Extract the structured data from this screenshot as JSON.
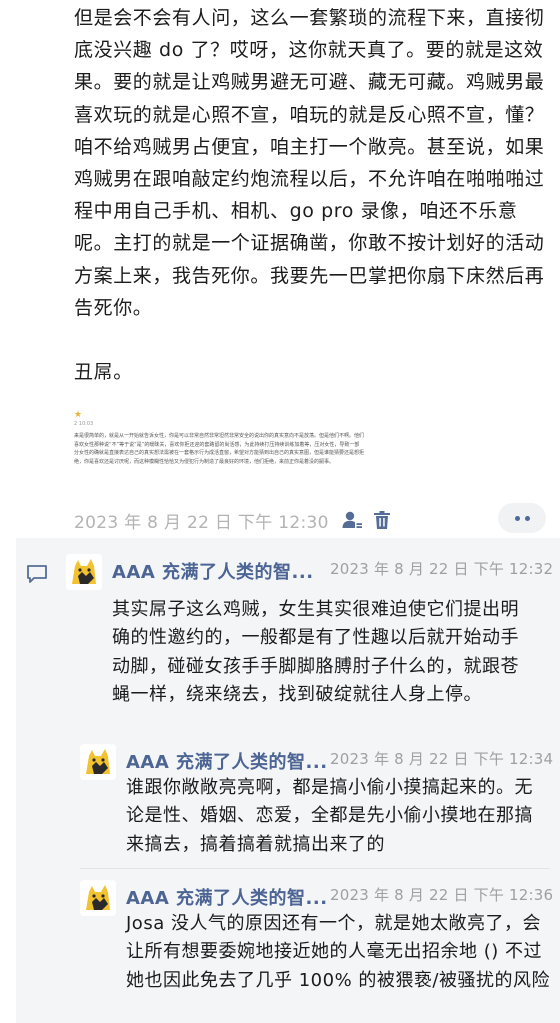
{
  "post": {
    "body_paragraph": "但是会不会有人问，这么一套繁琐的流程下来，直接彻底没兴趣 do 了？哎呀，这你就天真了。要的就是这效果。要的就是让鸡贼男避无可避、藏无可藏。鸡贼男最喜欢玩的就是心照不宣，咱玩的就是反心照不宣，懂？咱不给鸡贼男占便宜，咱主打一个敞亮。甚至说，如果鸡贼男在跟咱敲定约炮流程以后，不允许咱在啪啪啪过程中用自己手机、相机、go pro 录像，咱还不乐意呢。主打的就是一个证据确凿，你敢不按计划好的活动方案上来，我告死你。我要先一巴掌把你扇下床然后再告死你。",
    "closing_line": "丑屌。",
    "embedded_image": {
      "star": "★",
      "time": "2 10:03",
      "text": "来是很简单的，就是从一开始就告诉女性，你是可以非常自然非常坦然非常安全的说出你的真实意向不是放荡。但是他们不啊。他们喜欢女性那种说“不”等于说“是”的暧昧关，喜欢你拒还迎的套路留的尚活感，为此持续打压持续训练加着等，压对女性，导致一部分女性的确就是直接表达自己的真实想法需被在一套格示行为成活直窗，希望对方能猜到出自己的真实意图，但是谁能猜要还是想拒绝，你是喜欢还是讨厌呢，而这种模糊性恰恰又为侵犯行为制造了最良好的环境，他们拒绝，来前正你是着没的嗣事。"
    },
    "timestamp": "2023 年 8 月 22 日 下午 12:30"
  },
  "comments": [
    {
      "author": "AAA 充满了人类的智...",
      "time": "2023 年 8 月 22 日 下午 12:32",
      "text": "其实屌子这么鸡贼，女生其实很难迫使它们提出明确的性邀约的，一般都是有了性趣以后就开始动手动脚，碰碰女孩手手脚脚胳膊肘子什么的，就跟苍蝇一样，绕来绕去，找到破绽就往人身上停。"
    },
    {
      "author": "AAA 充满了人类的智...",
      "time": "2023 年 8 月 22 日 下午 12:34",
      "text": "谁跟你敞敞亮亮啊，都是搞小偷小摸搞起来的。无论是性、婚姻、恋爱，全都是先小偷小摸地在那搞来搞去，搞着搞着就搞出来了的"
    },
    {
      "author": "AAA 充满了人类的智...",
      "time": "2023 年 8 月 22 日 下午 12:36",
      "text": "Josa 没人气的原因还有一个，就是她太敞亮了，会让所有想要委婉地接近她的人毫无出招余地 () 不过她也因此免去了几乎 100% 的被猥亵/被骚扰的风险"
    }
  ],
  "icons": {
    "user": "user-tag-icon",
    "trash": "trash-icon",
    "more": "more-dots-icon",
    "comment": "comment-bubble-icon",
    "avatar": "yellow-cat-avatar"
  },
  "colors": {
    "link_name": "#4d6594",
    "timestamp": "#b3b3b3",
    "comment_bg": "#f4f5f7",
    "more_dots": "#4a6aa0"
  }
}
